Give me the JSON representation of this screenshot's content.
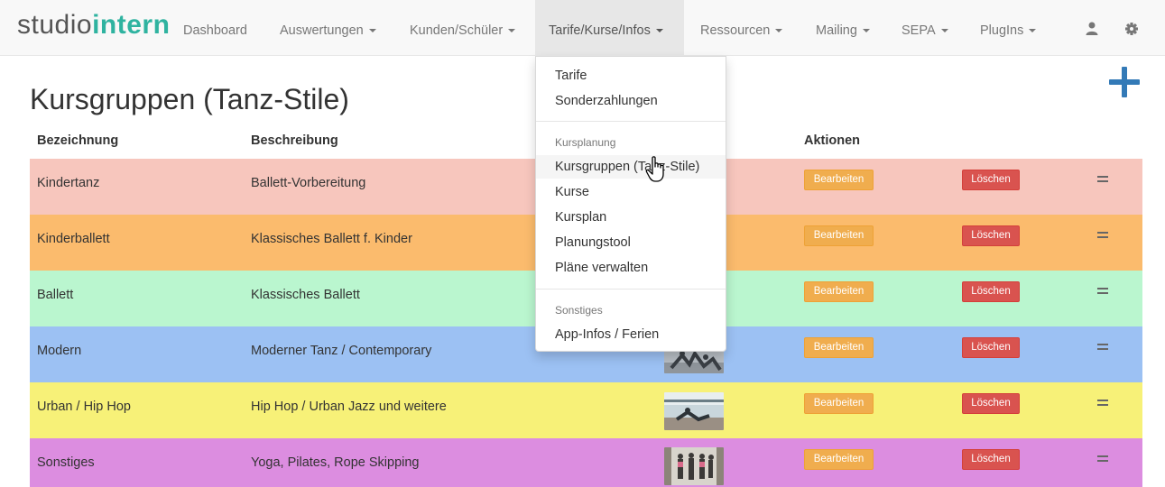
{
  "brand": {
    "part1": "studio",
    "part2": "intern"
  },
  "nav": {
    "dashboard": "Dashboard",
    "auswertungen": "Auswertungen",
    "kunden": "Kunden/Schüler",
    "tarife": "Tarife/Kurse/Infos",
    "ressourcen": "Ressourcen",
    "mailing": "Mailing",
    "sepa": "SEPA",
    "plugins": "PlugIns"
  },
  "page": {
    "title": "Kursgruppen (Tanz-Stile)"
  },
  "table": {
    "headers": {
      "bezeichnung": "Bezeichnung",
      "beschreibung": "Beschreibung",
      "aktionen": "Aktionen"
    },
    "edit_label": "Bearbeiten",
    "delete_label": "Löschen",
    "rows": [
      {
        "name": "Kindertanz",
        "description": "Ballett-Vorbereitung",
        "color": "#f7c6bd"
      },
      {
        "name": "Kinderballett",
        "description": "Klassisches Ballett f. Kinder",
        "color": "#fbbb6d"
      },
      {
        "name": "Ballett",
        "description": "Klassisches Ballett",
        "color": "#baf6cf"
      },
      {
        "name": "Modern",
        "description": "Moderner Tanz / Contemporary",
        "color": "#9cc1f3"
      },
      {
        "name": "Urban / Hip Hop",
        "description": "Hip Hop / Urban Jazz und weitere",
        "color": "#f7f178"
      },
      {
        "name": "Sonstiges",
        "description": "Yoga, Pilates, Rope Skipping",
        "color": "#dc8de0"
      }
    ]
  },
  "dropdown": {
    "tarife": "Tarife",
    "sonderzahlungen": "Sonderzahlungen",
    "header_kursplanung": "Kursplanung",
    "kursgruppen": "Kursgruppen (Tanz-Stile)",
    "kurse": "Kurse",
    "kursplan": "Kursplan",
    "planungstool": "Planungstool",
    "plaene": "Pläne verwalten",
    "header_sonstiges": "Sonstiges",
    "appinfos": "App-Infos / Ferien"
  },
  "icons": {
    "user": "user-icon",
    "settings": "gear-icon",
    "add": "plus-icon",
    "drag": "drag-handle-icon"
  }
}
